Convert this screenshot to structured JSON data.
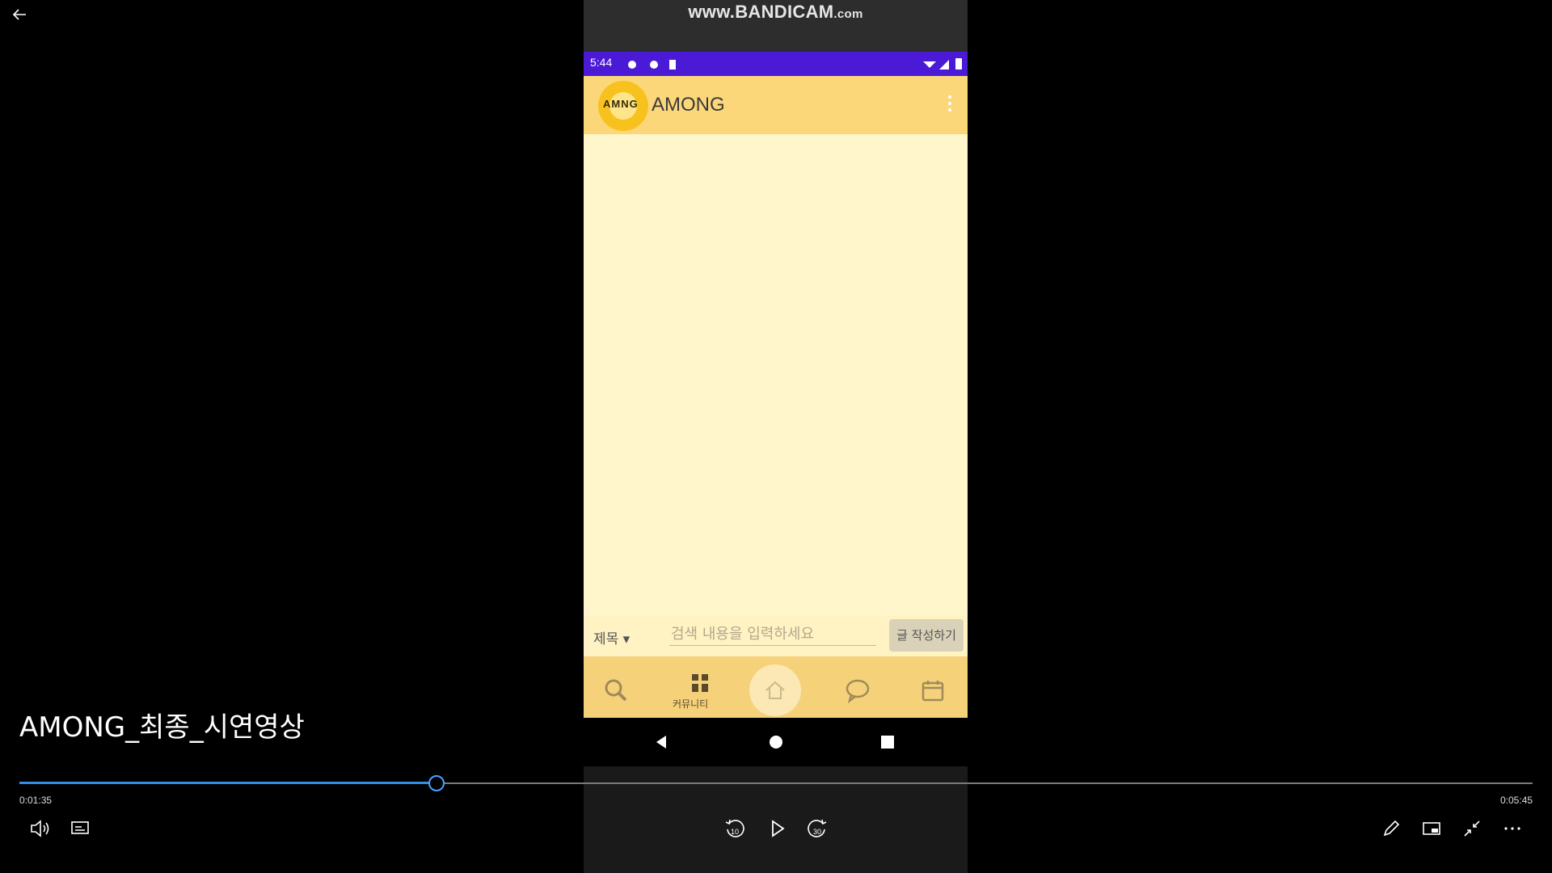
{
  "window": {
    "back_icon": "back-arrow-icon"
  },
  "video": {
    "title": "AMONG_최종_시연영상",
    "current_time": "0:01:35",
    "total_time": "0:05:45",
    "progress_fraction": 0.2754,
    "accent_color": "#2f8fe6"
  },
  "recording": {
    "watermark_main": "www.BANDICAM",
    "watermark_suffix": ".com"
  },
  "phone": {
    "status_time": "5:44",
    "app_title": "AMONG",
    "logo_text": "AMNG",
    "header_color": "#fcd77a",
    "content_color": "#fff6cc",
    "search": {
      "type_label": "제목 ▾",
      "placeholder": "검색 내용을 입력하세요",
      "write_button": "글 작성하기"
    },
    "bottom_nav": {
      "community_label": "커뮤니티",
      "icons": [
        "search-icon",
        "community-icon",
        "home-icon",
        "chat-icon",
        "calendar-icon"
      ]
    }
  },
  "controls": {
    "left": [
      "volume-icon",
      "subtitles-icon"
    ],
    "center": [
      "rewind-10-icon",
      "play-icon",
      "forward-30-icon"
    ],
    "rewind_label": "10",
    "forward_label": "30",
    "right": [
      "edit-icon",
      "mini-view-icon",
      "exit-fullscreen-icon",
      "more-icon"
    ]
  }
}
